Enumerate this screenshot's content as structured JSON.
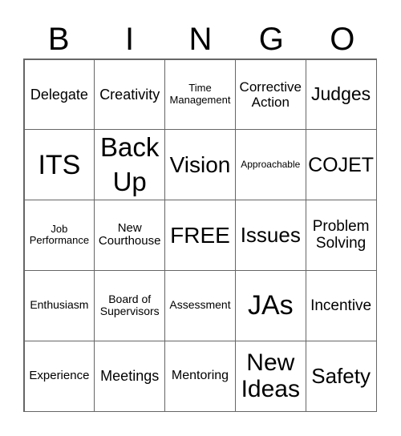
{
  "header": [
    "B",
    "I",
    "N",
    "G",
    "O"
  ],
  "cells": [
    [
      "Delegate",
      "Creativity",
      "Time Management",
      "Corrective Action",
      "Judges"
    ],
    [
      "ITS",
      "Back Up",
      "Vision",
      "Approachable",
      "COJET"
    ],
    [
      "Job Performance",
      "New Courthouse",
      "FREE",
      "Issues",
      "Problem Solving"
    ],
    [
      "Enthusiasm",
      "Board of Supervisors",
      "Assessment",
      "JAs",
      "Incentive"
    ],
    [
      "Experience",
      "Meetings",
      "Mentoring",
      "New Ideas",
      "Safety"
    ]
  ]
}
